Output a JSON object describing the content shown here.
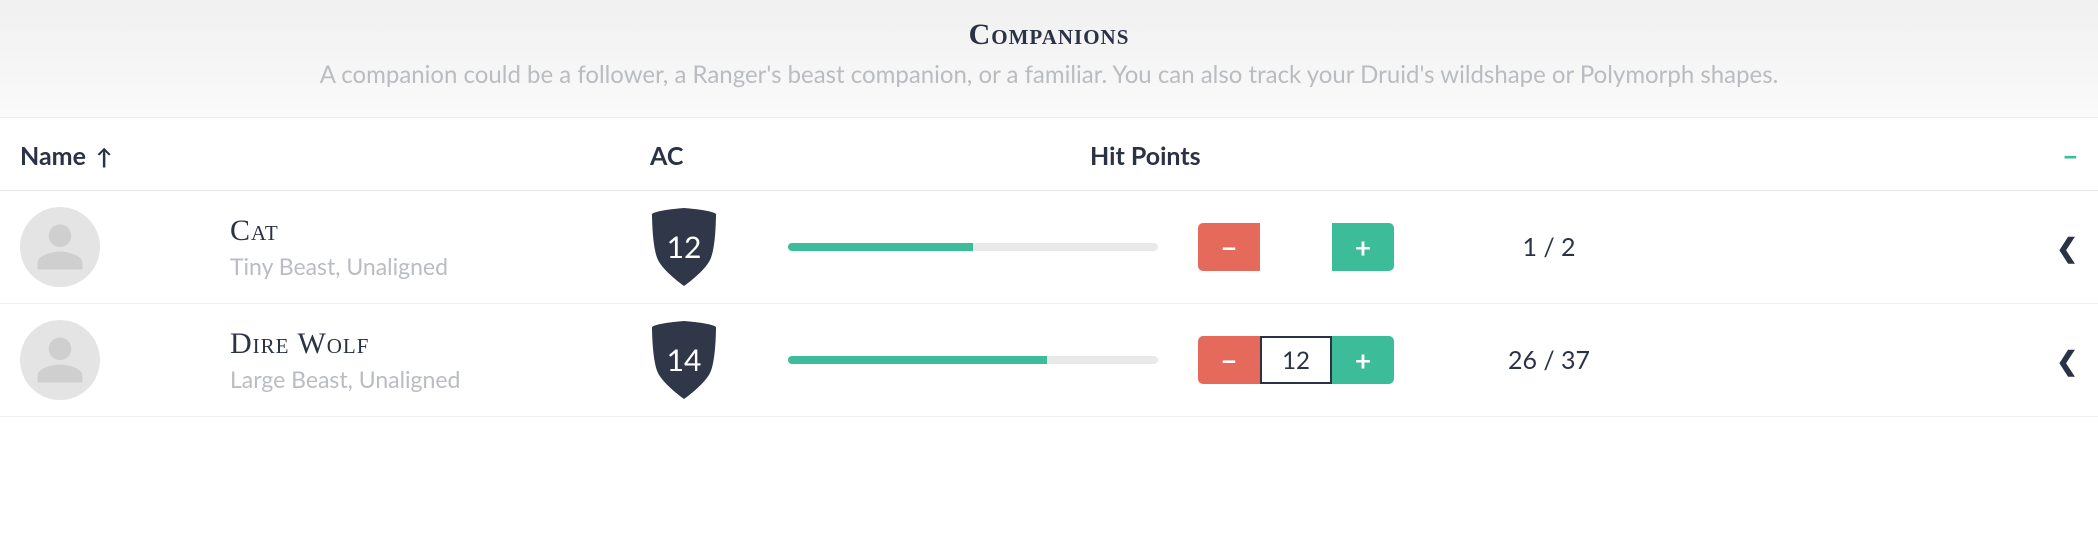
{
  "header": {
    "title": "Companions",
    "subtitle": "A companion could be a follower, a Ranger's beast companion, or a familiar. You can also track your Druid's wildshape or Polymorph shapes."
  },
  "columns": {
    "name": "Name",
    "ac": "AC",
    "hp": "Hit Points"
  },
  "rows": [
    {
      "name": "Cat",
      "subtitle": "Tiny Beast, Unaligned",
      "ac": "12",
      "hp_current": 1,
      "hp_max": 2,
      "hp_text": "1 / 2",
      "hp_percent": 50,
      "input_value": "",
      "input_active": false
    },
    {
      "name": "Dire Wolf",
      "subtitle": "Large Beast, Unaligned",
      "ac": "14",
      "hp_current": 26,
      "hp_max": 37,
      "hp_text": "26 / 37",
      "hp_percent": 70,
      "input_value": "12",
      "input_active": true
    }
  ]
}
